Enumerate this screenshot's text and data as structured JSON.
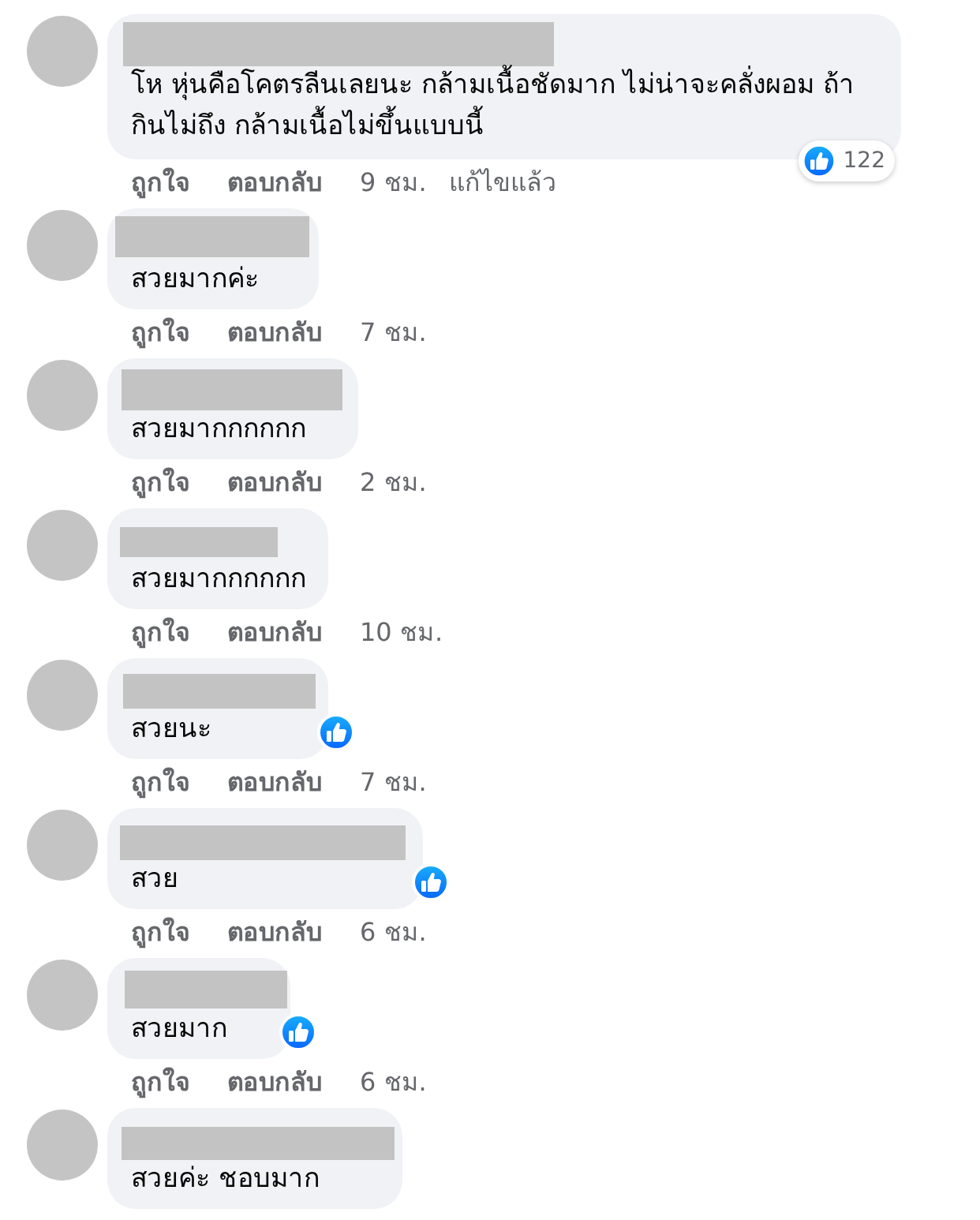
{
  "comments": [
    {
      "name_redacted": true,
      "text": "โห หุ่นคือโคตรลีนเลยนะ กล้ามเนื้อชัดมาก ไม่น่าจะคลั่งผอม ถ้ากินไม่ถึง กล้ามเนื้อไม่ขึ้นแบบนี้",
      "reaction": {
        "kind": "like",
        "count": "122"
      },
      "actions": [
        "ถูกใจ",
        "ตอบกลับ"
      ],
      "time": "9 ชม.",
      "edited": "แก้ไขแล้ว"
    },
    {
      "name_redacted": true,
      "text": "สวยมากค่ะ",
      "actions": [
        "ถูกใจ",
        "ตอบกลับ"
      ],
      "time": "7 ชม."
    },
    {
      "name_redacted": true,
      "text": "สวยมากกกกกก",
      "actions": [
        "ถูกใจ",
        "ตอบกลับ"
      ],
      "time": "2 ชม."
    },
    {
      "name_redacted": true,
      "text": "สวยมากกกกกก",
      "actions": [
        "ถูกใจ",
        "ตอบกลับ"
      ],
      "time": "10 ชม."
    },
    {
      "name_redacted": true,
      "text": "สวยนะ",
      "reaction": {
        "kind": "like"
      },
      "actions": [
        "ถูกใจ",
        "ตอบกลับ"
      ],
      "time": "7 ชม."
    },
    {
      "name_redacted": true,
      "text": "สวย",
      "reaction": {
        "kind": "like"
      },
      "actions": [
        "ถูกใจ",
        "ตอบกลับ"
      ],
      "time": "6 ชม."
    },
    {
      "name_redacted": true,
      "text": "สวยมาก",
      "reaction": {
        "kind": "like"
      },
      "actions": [
        "ถูกใจ",
        "ตอบกลับ"
      ],
      "time": "6 ชม."
    },
    {
      "name_redacted": true,
      "text": "สวยค่ะ ชอบมาก"
    }
  ]
}
